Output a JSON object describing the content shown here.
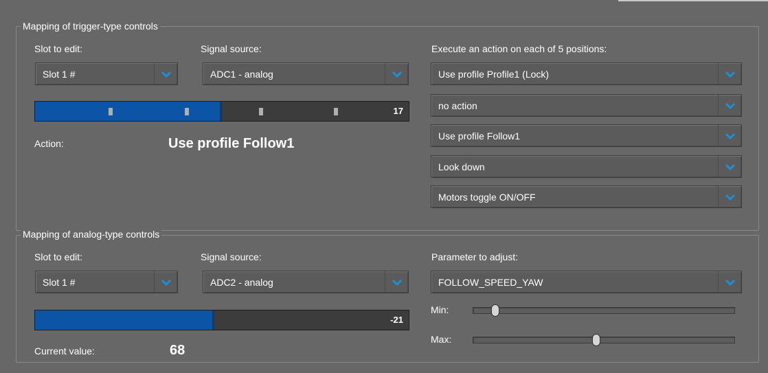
{
  "trigger": {
    "title": "Mapping of trigger-type controls",
    "slot_label": "Slot to edit:",
    "slot_value": "Slot 1 #",
    "source_label": "Signal source:",
    "source_value": "ADC1 - analog",
    "bar_value": "17",
    "bar_fill_fraction": 0.5,
    "action_label": "Action:",
    "action_value": "Use profile Follow1",
    "positions_label": "Execute an action on each of 5 positions:",
    "positions": [
      "Use profile Profile1 (Lock)",
      "no action",
      "Use profile Follow1",
      "Look down",
      "Motors toggle ON/OFF"
    ]
  },
  "analog": {
    "title": "Mapping of analog-type controls",
    "slot_label": "Slot to edit:",
    "slot_value": "Slot 1 #",
    "source_label": "Signal source:",
    "source_value": "ADC2 - analog",
    "bar_value": "-21",
    "bar_fill_fraction": 0.48,
    "current_label": "Current value:",
    "current_value": "68",
    "param_label": "Parameter to adjust:",
    "param_value": "FOLLOW_SPEED_YAW",
    "min_label": "Min:",
    "max_label": "Max:",
    "min_level": 0.07,
    "max_level": 0.47
  },
  "colors": {
    "background": "#676767",
    "bar_fill": "#0b54a6",
    "chevron": "#1e8fd6"
  },
  "icons": {
    "dropdown": "chevron-down-icon"
  }
}
